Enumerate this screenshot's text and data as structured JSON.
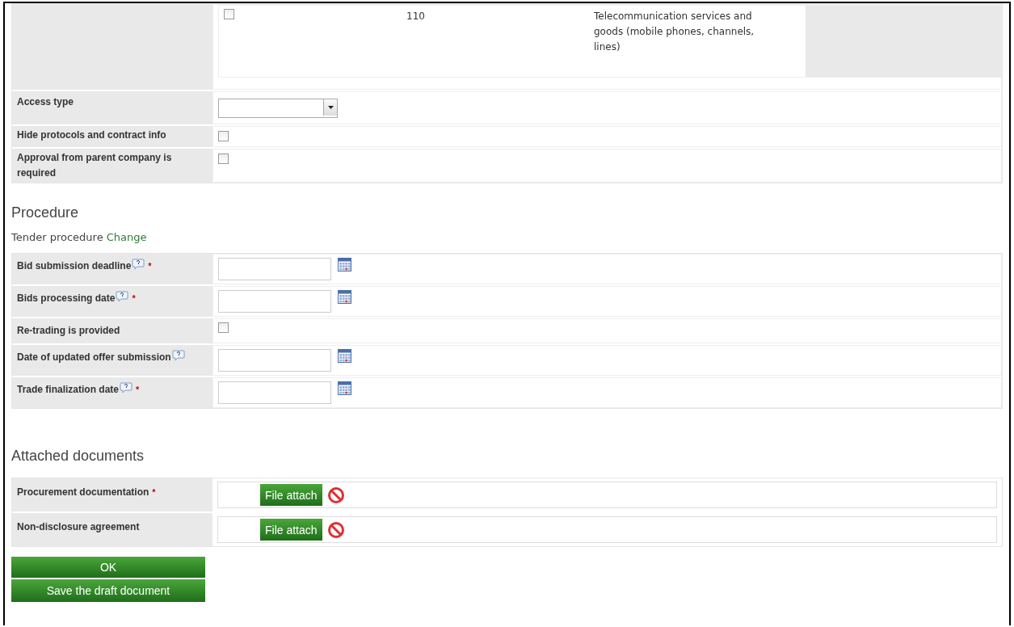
{
  "category_row": {
    "checked": false,
    "code": "110",
    "description": "Telecommunication services and goods (mobile phones, channels, lines)"
  },
  "settings": [
    {
      "kind": "select",
      "label": "Access type"
    },
    {
      "kind": "checkbox",
      "label": "Hide protocols and contract info",
      "checked": false
    },
    {
      "kind": "checkbox",
      "label": "Approval from parent company is required",
      "checked": false
    }
  ],
  "procedure": {
    "heading": "Procedure",
    "type_text": "Tender procedure",
    "change_link": "Change",
    "fields": [
      {
        "kind": "date",
        "label": "Bid submission deadline",
        "help": true,
        "required_mark": "*"
      },
      {
        "kind": "date",
        "label": "Bids processing date",
        "help": true,
        "required_mark": "*"
      },
      {
        "kind": "checkbox",
        "label": "Re-trading is provided",
        "help": false,
        "checked": false
      },
      {
        "kind": "date",
        "label": "Date of updated offer submission",
        "help": true
      },
      {
        "kind": "date",
        "label": "Trade finalization date",
        "help": true,
        "required_mark": "*"
      }
    ]
  },
  "documents": {
    "heading": "Attached documents",
    "items": [
      {
        "label": "Procurement documentation",
        "required_mark": "*",
        "button": "File attach"
      },
      {
        "label": "Non-disclosure agreement",
        "button": "File attach"
      }
    ]
  },
  "buttons": [
    {
      "label": "OK"
    },
    {
      "label": "Save the draft document"
    }
  ]
}
